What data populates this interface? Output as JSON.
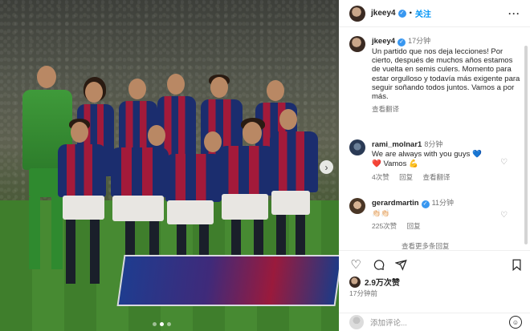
{
  "header": {
    "username": "jkeey4",
    "separator": "•",
    "follow_label": "关注",
    "more_icon": "more-horizontal-icon"
  },
  "caption": {
    "username": "jkeey4",
    "time": "17分钟",
    "text": "Un partido que nos deja lecciones! Por cierto, después de muchos años estamos de vuelta en semis culers. Momento para estar orgulloso y todavía más exigente para seguir soñando todos juntos. Vamos a por más.",
    "translate": "查看翻译"
  },
  "comments": [
    {
      "username": "rami_molnar1",
      "time": "8分钟",
      "line1": "We are always with you guys 💙",
      "line2": "❤️ Vamos 💪",
      "likes": "4次赞",
      "reply": "回复",
      "translate": "查看翻译"
    },
    {
      "username": "gerardmartin",
      "time": "11分钟",
      "line1": "👏🏻👏🏻",
      "likes": "225次赞",
      "reply": "回复"
    }
  ],
  "view_more": "查看更多条回复",
  "actions": [
    "heart-icon",
    "comment-icon",
    "share-icon",
    "bookmark-icon"
  ],
  "likes_count": "2.9万次赞",
  "posted_time": "17分钟前",
  "add_comment_placeholder": "添加评论...",
  "emoji_icon": "smile-icon",
  "photo": {
    "description_icon": "team-photo",
    "dots": 3,
    "active_dot": 1
  },
  "colors": {
    "accent": "#0095f6",
    "verified": "#3897f0",
    "barca_blue": "#1b2d6e",
    "barca_red": "#a31a3a"
  }
}
